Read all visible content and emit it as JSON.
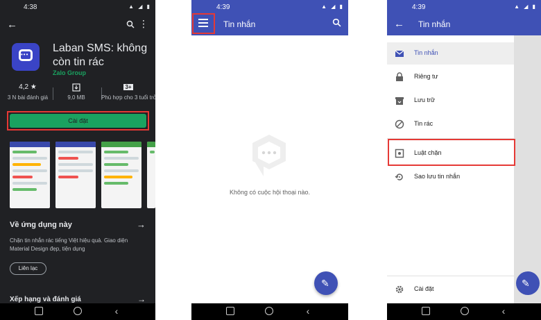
{
  "playstore": {
    "time": "4:38",
    "app_title": "Laban SMS: không còn tin rác",
    "developer": "Zalo Group",
    "rating_value": "4,2 ★",
    "rating_label": "3 N bài đánh giá",
    "size_label": "9,0 MB",
    "age_badge": "3+",
    "age_label": "Phù hợp cho 3 tuổi trở",
    "install_label": "Cài đặt",
    "about_title": "Về ứng dụng này",
    "about_desc": "Chặn tin nhắn rác tiếng Việt hiệu quả. Giao diện Material Design đẹp, tiện dụng",
    "contact_label": "Liên lạc",
    "ratings_title": "Xếp hạng và đánh giá",
    "accent": "#1aa260"
  },
  "laban_main": {
    "time": "4:39",
    "title": "Tin nhắn",
    "empty_text": "Không có cuộc hội thoại nào.",
    "accent": "#3f51b5"
  },
  "laban_drawer": {
    "time": "4:39",
    "title": "Tin nhắn",
    "items": [
      {
        "label": "Tin nhắn",
        "icon": "mail-icon"
      },
      {
        "label": "Riêng tư",
        "icon": "lock-icon"
      },
      {
        "label": "Lưu trữ",
        "icon": "archive-icon"
      },
      {
        "label": "Tin rác",
        "icon": "block-icon"
      },
      {
        "label": "Luật chặn",
        "icon": "filter-rule-icon"
      },
      {
        "label": "Sao lưu tin nhắn",
        "icon": "backup-restore-icon"
      }
    ],
    "settings_label": "Cài đặt"
  }
}
